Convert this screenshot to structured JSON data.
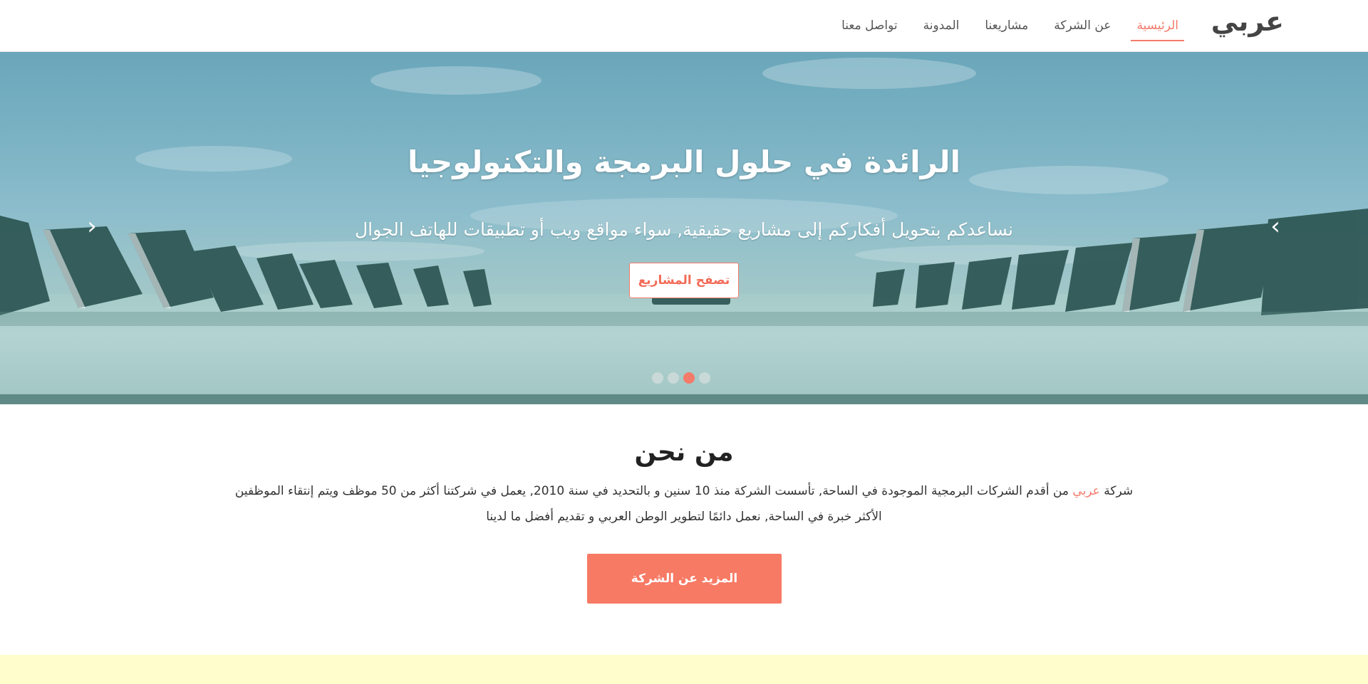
{
  "brand": {
    "name": "عربي"
  },
  "nav": {
    "items": [
      {
        "label": "الرئيسية",
        "active": true
      },
      {
        "label": "عن الشركة",
        "active": false
      },
      {
        "label": "مشاريعنا",
        "active": false
      },
      {
        "label": "المدونة",
        "active": false
      },
      {
        "label": "تواصل معنا",
        "active": false
      }
    ]
  },
  "hero": {
    "title": "الرائدة في حلول البرمجة والتكنولوجيا",
    "subtitle": "نساعدكم بتحويل أفكاركم إلى مشاريع حقيقية, سواء مواقع ويب أو تطبيقات للهاتف الجوال",
    "button_label": "تصفح المشاريع",
    "prev_icon": "chevron-left-icon",
    "next_icon": "chevron-right-icon",
    "slides_count": 4,
    "active_slide": 3
  },
  "about": {
    "title": "من نحن",
    "text_before_accent": "شركة ",
    "accent": "عربي",
    "text_after_accent": " من أقدم الشركات البرمجية الموجودة في الساحة, تأسست الشركة منذ 10 سنين و بالتحديد في سنة 2010, يعمل في شركتنا أكثر من 50 موظف ويتم إنتقاء الموظفين الأكثر خبرة في الساحة, نعمل دائمًا لتطوير الوطن العربي و تقديم أفضل ما لدينا",
    "button_label": "المزيد عن الشركة"
  },
  "colors": {
    "accent": "#f47a6a",
    "button": "#f77a65",
    "yellow_band": "#fffdcc"
  }
}
